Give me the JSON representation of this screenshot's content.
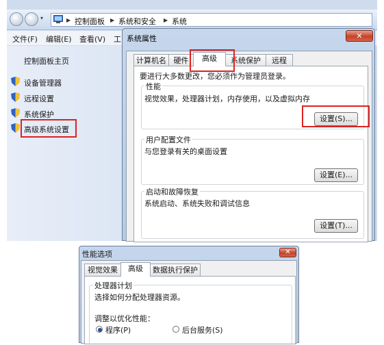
{
  "explorer": {
    "breadcrumb": [
      "控制面板",
      "系统和安全",
      "系统"
    ],
    "menu": [
      "文件(F)",
      "编辑(E)",
      "查看(V)",
      "工"
    ],
    "sidebar": {
      "home": "控制面板主页",
      "items": [
        "设备管理器",
        "远程设置",
        "系统保护",
        "高级系统设置"
      ]
    }
  },
  "sys_dialog": {
    "title": "系统属性",
    "close": "✕",
    "tabs": [
      "计算机名",
      "硬件",
      "高级",
      "系统保护",
      "远程"
    ],
    "active_tab": "高级",
    "admin_note": "要进行大多数更改，您必须作为管理员登录。",
    "groups": [
      {
        "title": "性能",
        "desc": "视觉效果，处理器计划，内存使用，以及虚拟内存",
        "button": "设置(S)..."
      },
      {
        "title": "用户配置文件",
        "desc": "与您登录有关的桌面设置",
        "button": "设置(E)..."
      },
      {
        "title": "启动和故障恢复",
        "desc": "系统启动、系统失败和调试信息",
        "button": "设置(T)..."
      }
    ]
  },
  "perf_dialog": {
    "title": "性能选项",
    "close": "✕",
    "tabs": [
      "视觉效果",
      "高级",
      "数据执行保护"
    ],
    "active_tab": "高级",
    "group_title": "处理器计划",
    "group_desc": "选择如何分配处理器资源。",
    "adjust_label": "调整以优化性能：",
    "radio_options": [
      {
        "label": "程序(P)",
        "selected": true
      },
      {
        "label": "后台服务(S)",
        "selected": false
      }
    ]
  },
  "colors": {
    "highlight_box": "#e02020",
    "title_bar": "#c6d7ec",
    "close_button": "#c5432a"
  }
}
